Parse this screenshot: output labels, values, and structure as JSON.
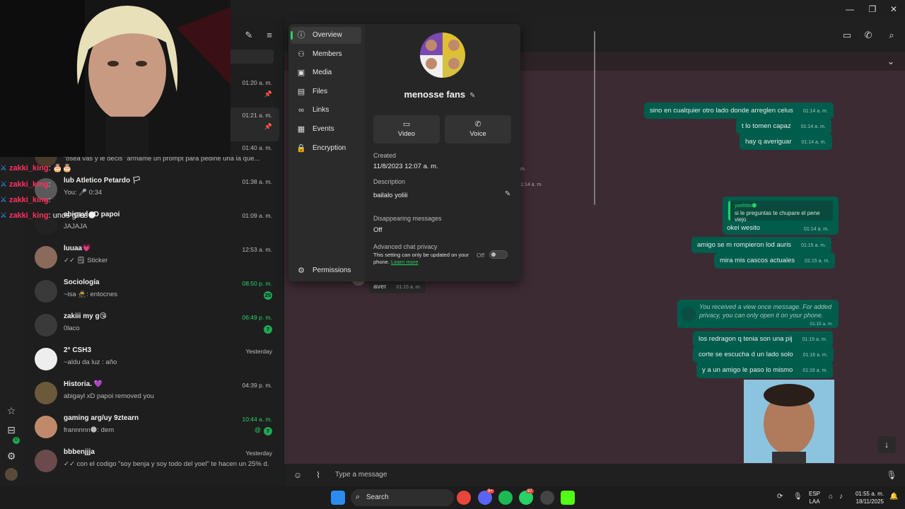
{
  "titlebar": {
    "minimize": "—",
    "maximize": "❐",
    "close": "✕"
  },
  "chatlist": {
    "items": [
      {
        "name": "",
        "preview": "",
        "time": "01:20 a. m.",
        "pinned": true
      },
      {
        "name": "",
        "preview": "",
        "time": "01:21 a. m.",
        "pinned": true
      },
      {
        "name": "",
        "preview": "“osea vas y le decis \"armame un prompt para pedirle una ia que...",
        "time": "01:40 a. m."
      },
      {
        "name": "lub Atletico Petardo 🏳",
        "preview": "You: 🎤 0:34",
        "time": "01:38 a. m."
      },
      {
        "name": "abigayl xD papoi",
        "preview": "JAJAJA",
        "time": "01:09 a. m."
      },
      {
        "name": "luuaa💗",
        "preview": "✓✓ 🗒 Sticker",
        "time": "12:53 a. m."
      },
      {
        "name": "Sociología",
        "preview": "~isa 🥷: entocnes",
        "time": "08:50 p. m.",
        "badge": "25"
      },
      {
        "name": "zakiii my g😘",
        "preview": "0laco",
        "time": "06:49 p. m.",
        "badge": "7"
      },
      {
        "name": "2° CSH3",
        "preview": "~aldu da luz : año",
        "time": "Yesterday"
      },
      {
        "name": "Historia. 💜",
        "preview": "abigayl xD papoi removed you",
        "time": "04:39 p. m."
      },
      {
        "name": "gaming arg/uy 9ztearn",
        "preview": "frannnnn🌑: dem",
        "time": "10:44 a. m.",
        "badge": "7",
        "mention": "@"
      },
      {
        "name": "bbbenjjja",
        "preview": "✓✓ con el codigo \"soy benja y soy todo del yoel\" te hacen un 25% d...",
        "time": "Yesterday"
      }
    ]
  },
  "twitch_chat": [
    {
      "user": "zakki_king",
      "msg": "🎂🎂"
    },
    {
      "user": "zakki_king",
      "msg": ""
    },
    {
      "user": "zakki_king",
      "msg": ""
    },
    {
      "user": "zakki_king",
      "msg": "unos giles🌑"
    }
  ],
  "popover": {
    "nav": [
      "Overview",
      "Members",
      "Media",
      "Files",
      "Links",
      "Events",
      "Encryption"
    ],
    "permissions": "Permissions",
    "group_name": "menosse fans",
    "video_label": "Video",
    "voice_label": "Voice",
    "created_label": "Created",
    "created_value": "11/8/2023 12:07 a. m.",
    "description_label": "Description",
    "description_value": "bailalo yoliii",
    "disappearing_label": "Disappearing messages",
    "disappearing_value": "Off",
    "privacy_label": "Advanced chat privacy",
    "privacy_note": "This setting can only be updated on your phone.",
    "learn_more": "Learn more",
    "privacy_toggle": "Off"
  },
  "messages": {
    "out": [
      {
        "text": "sino en cualquier otro lado donde arreglen celus",
        "time": "01:14 a. m."
      },
      {
        "text": "t lo tomen capaz",
        "time": "01:14 a. m."
      },
      {
        "text": "hay q averiguar",
        "time": "01:14 a. m."
      },
      {
        "text": "okei wesito",
        "time": "01:14 a. m."
      },
      {
        "text": "amigo se m rompieron lod auris",
        "time": "01:15 a. m."
      },
      {
        "text": "mira mis cascos actuales",
        "time": "01:15 a. m."
      },
      {
        "text": "los redragon q tenia son una pij",
        "time": "01:15 a. m."
      },
      {
        "text": "corte se escucha d un lado solo",
        "time": "01:16 a. m."
      },
      {
        "text": "y a un amigo le paso lo mismo",
        "time": "01:16 a. m."
      }
    ],
    "quote_name": "yoelittto🌑",
    "quote_text": "si le preguntas te chupare el pene viejo",
    "view_once": "You received a view once message. For added privacy, you can only open it on your phone.",
    "view_once_time": "01:15 a. m.",
    "incoming": {
      "text": "aver",
      "time": "01:15 a. m."
    },
    "partial_time_1": "m.",
    "partial_time_2": "1:14 a. m."
  },
  "composer": {
    "placeholder": "Type a message"
  },
  "taskbar": {
    "search": "Search",
    "lang_top": "ESP",
    "lang_bottom": "LAA",
    "time": "01:55 a. m.",
    "date": "18/11/2025",
    "spotify_badge": "97",
    "discord_badge": "9+"
  },
  "colors": {
    "accent": "#25d366",
    "bubble_out": "#005c4b",
    "chat_bg": "#3d2b33"
  }
}
